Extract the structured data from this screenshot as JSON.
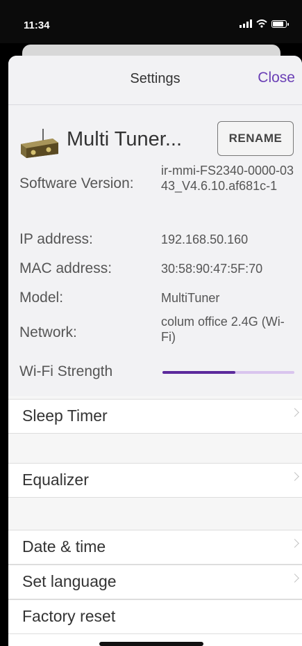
{
  "status_bar": {
    "time": "11:34"
  },
  "nav": {
    "title": "Settings",
    "close_label": "Close"
  },
  "device": {
    "name": "Multi Tuner...",
    "rename_label": "RENAME"
  },
  "info": {
    "software_version_label": "Software Version:",
    "software_version_value": "ir-mmi-FS2340-0000-0343_V4.6.10.af681c-1",
    "ip_label": "IP address:",
    "ip_value": "192.168.50.160",
    "mac_label": "MAC address:",
    "mac_value": "30:58:90:47:5F:70",
    "model_label": "Model:",
    "model_value": "MultiTuner",
    "network_label": "Network:",
    "network_value": "colum office 2.4G (Wi-Fi)",
    "wifi_strength_label": "Wi-Fi Strength",
    "wifi_strength_fraction": 0.55
  },
  "menu": {
    "sleep_timer": "Sleep Timer",
    "equalizer": "Equalizer",
    "date_time": "Date & time",
    "set_language": "Set language",
    "factory_reset": "Factory reset"
  },
  "colors": {
    "accent": "#6a3fb5",
    "strength_fill": "#5c2a9c",
    "strength_track": "#d9c5ee"
  }
}
